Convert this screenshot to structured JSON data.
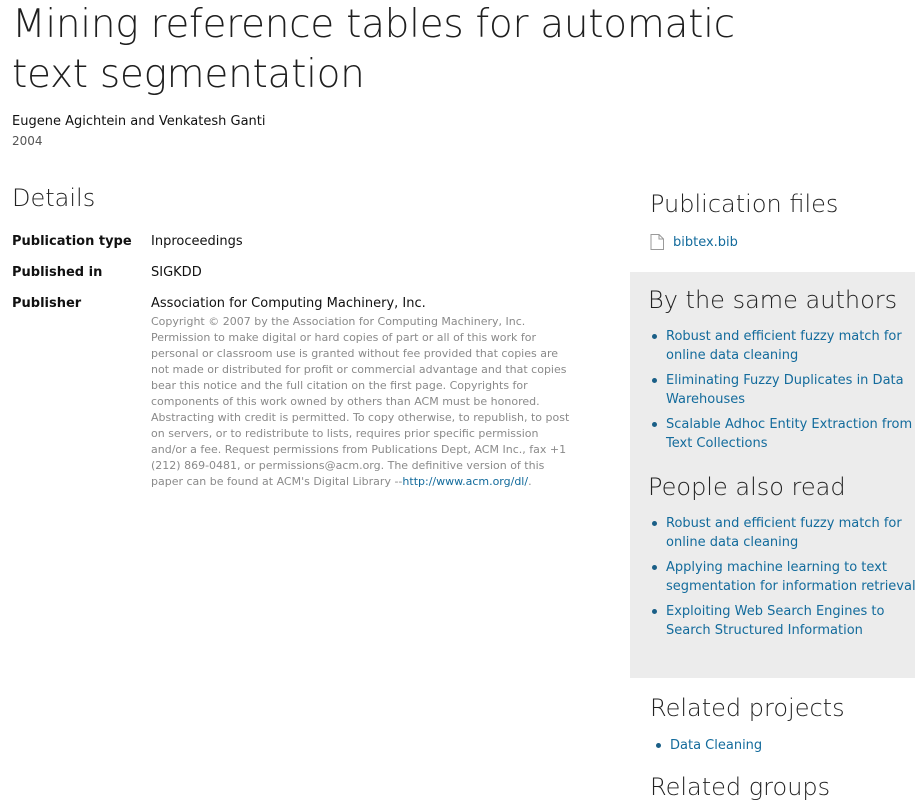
{
  "title": "Mining reference tables for automatic text segmentation",
  "authors": "Eugene Agichtein and Venkatesh Ganti",
  "year": "2004",
  "details": {
    "heading": "Details",
    "rows": [
      {
        "label": "Publication type",
        "value": "Inproceedings"
      },
      {
        "label": "Published in",
        "value": "SIGKDD"
      },
      {
        "label": "Publisher",
        "value": "Association for Computing Machinery, Inc."
      }
    ],
    "copyright_text": "Copyright © 2007 by the Association for Computing Machinery, Inc. Permission to make digital or hard copies of part or all of this work for personal or classroom use is granted without fee provided that copies are not made or distributed for profit or commercial advantage and that copies bear this notice and the full citation on the first page. Copyrights for components of this work owned by others than ACM must be honored. Abstracting with credit is permitted. To copy otherwise, to republish, to post on servers, or to redistribute to lists, requires prior specific permission and/or a fee. Request permissions from Publications Dept, ACM Inc., fax +1 (212) 869-0481, or permissions@acm.org. The definitive version of this paper can be found at ACM's Digital Library --",
    "copyright_link": "http://www.acm.org/dl/",
    "copyright_end": "."
  },
  "publication_files": {
    "heading": "Publication files",
    "file_icon": "document-icon",
    "file_name": "bibtex.bib"
  },
  "same_authors": {
    "heading": "By the same authors",
    "items": [
      "Robust and efficient fuzzy match for online data cleaning",
      "Eliminating Fuzzy Duplicates in Data Warehouses",
      "Scalable Adhoc Entity Extraction from Text Collections"
    ]
  },
  "also_read": {
    "heading": "People also read",
    "items": [
      "Robust and efficient fuzzy match for online data cleaning",
      "Applying machine learning to text segmentation for information retrieval",
      "Exploiting Web Search Engines to Search Structured Information"
    ]
  },
  "related_projects": {
    "heading": "Related projects",
    "items": [
      "Data Cleaning"
    ]
  },
  "related_groups": {
    "heading": "Related groups"
  },
  "colors": {
    "link": "#136b9c",
    "panel_background": "#ececec",
    "muted_text": "#8a8a8a"
  }
}
